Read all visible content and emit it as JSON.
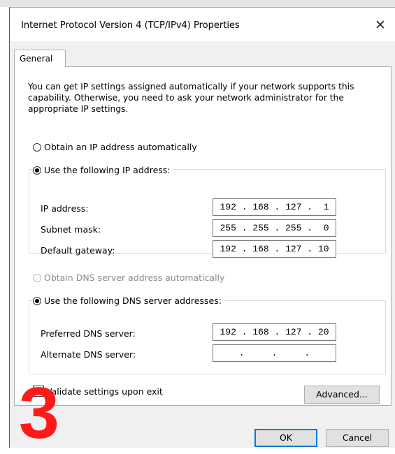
{
  "window": {
    "title": "Internet Protocol Version 4 (TCP/IPv4) Properties",
    "close_glyph": "✕"
  },
  "tabs": [
    {
      "label": "General"
    }
  ],
  "description": "You can get IP settings assigned automatically if your network supports this capability. Otherwise, you need to ask your network administrator for the appropriate IP settings.",
  "ip_options": {
    "auto_label": "Obtain an IP address automatically",
    "manual_label": "Use the following IP address:",
    "selected": "manual"
  },
  "ip_fields": [
    {
      "label": "IP address:",
      "value": "192 . 168 . 127 .  1"
    },
    {
      "label": "Subnet mask:",
      "value": "255 . 255 . 255 .  0"
    },
    {
      "label": "Default gateway:",
      "value": "192 . 168 . 127 . 10"
    }
  ],
  "dns_options": {
    "auto_label": "Obtain DNS server address automatically",
    "manual_label": "Use the following DNS server addresses:",
    "selected": "manual",
    "auto_disabled": true
  },
  "dns_fields": [
    {
      "label": "Preferred DNS server:",
      "value": "192 . 168 . 127 . 20"
    },
    {
      "label": "Alternate DNS server:",
      "value": "   .     .     .   "
    }
  ],
  "validate": {
    "label": "Validate settings upon exit",
    "checked": false
  },
  "buttons": {
    "advanced": "Advanced...",
    "ok": "OK",
    "cancel": "Cancel"
  },
  "overlay_number": "3",
  "colors": {
    "accent": "#0078d7",
    "overlay": "#ff1a1a",
    "dialog_bg": "#f0f0f0"
  }
}
